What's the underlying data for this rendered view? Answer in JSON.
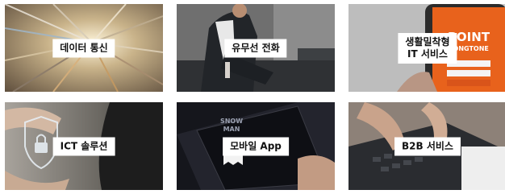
{
  "services": [
    {
      "label": "데이터 통신",
      "icon": "speed-light-trails-photo"
    },
    {
      "label": "유무선 전화",
      "icon": "businessman-phone-photo"
    },
    {
      "label_line1": "생활밀착형",
      "label_line2": "IT 서비스",
      "icon": "smartphone-point-app-photo",
      "photo_text_1": "POINT",
      "photo_text_2": "TONGTONE"
    },
    {
      "label": "ICT 솔루션",
      "icon": "security-lock-shield-photo"
    },
    {
      "label": "모바일 App",
      "icon": "mobile-app-ghost-photo",
      "photo_text_1": "SNOW",
      "photo_text_2": "MAN"
    },
    {
      "label": "B2B 서비스",
      "icon": "laptop-typing-photo"
    }
  ],
  "colors": {
    "label_bg": "#ffffff",
    "label_text": "#111111",
    "accent_orange": "#e8621c"
  }
}
